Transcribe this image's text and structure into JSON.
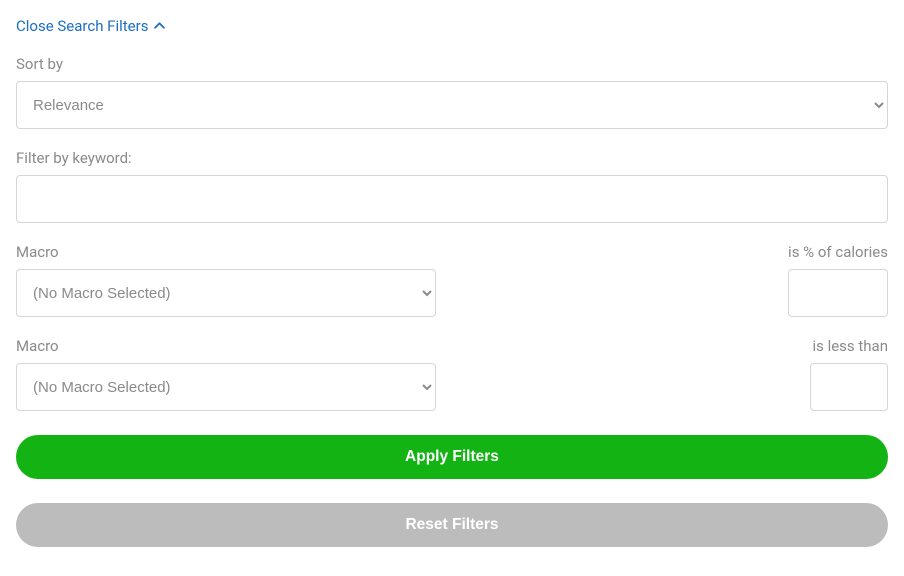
{
  "toggle": {
    "label": "Close Search Filters"
  },
  "sort": {
    "label": "Sort by",
    "selected": "Relevance"
  },
  "keyword": {
    "label": "Filter by keyword:",
    "value": ""
  },
  "macro1": {
    "label": "Macro",
    "selected": "(No Macro Selected)",
    "pct_label": "is % of calories",
    "pct_value": ""
  },
  "macro2": {
    "label": "Macro",
    "selected": "(No Macro Selected)",
    "lt_label": "is less than",
    "lt_value": ""
  },
  "buttons": {
    "apply": "Apply Filters",
    "reset": "Reset Filters"
  }
}
